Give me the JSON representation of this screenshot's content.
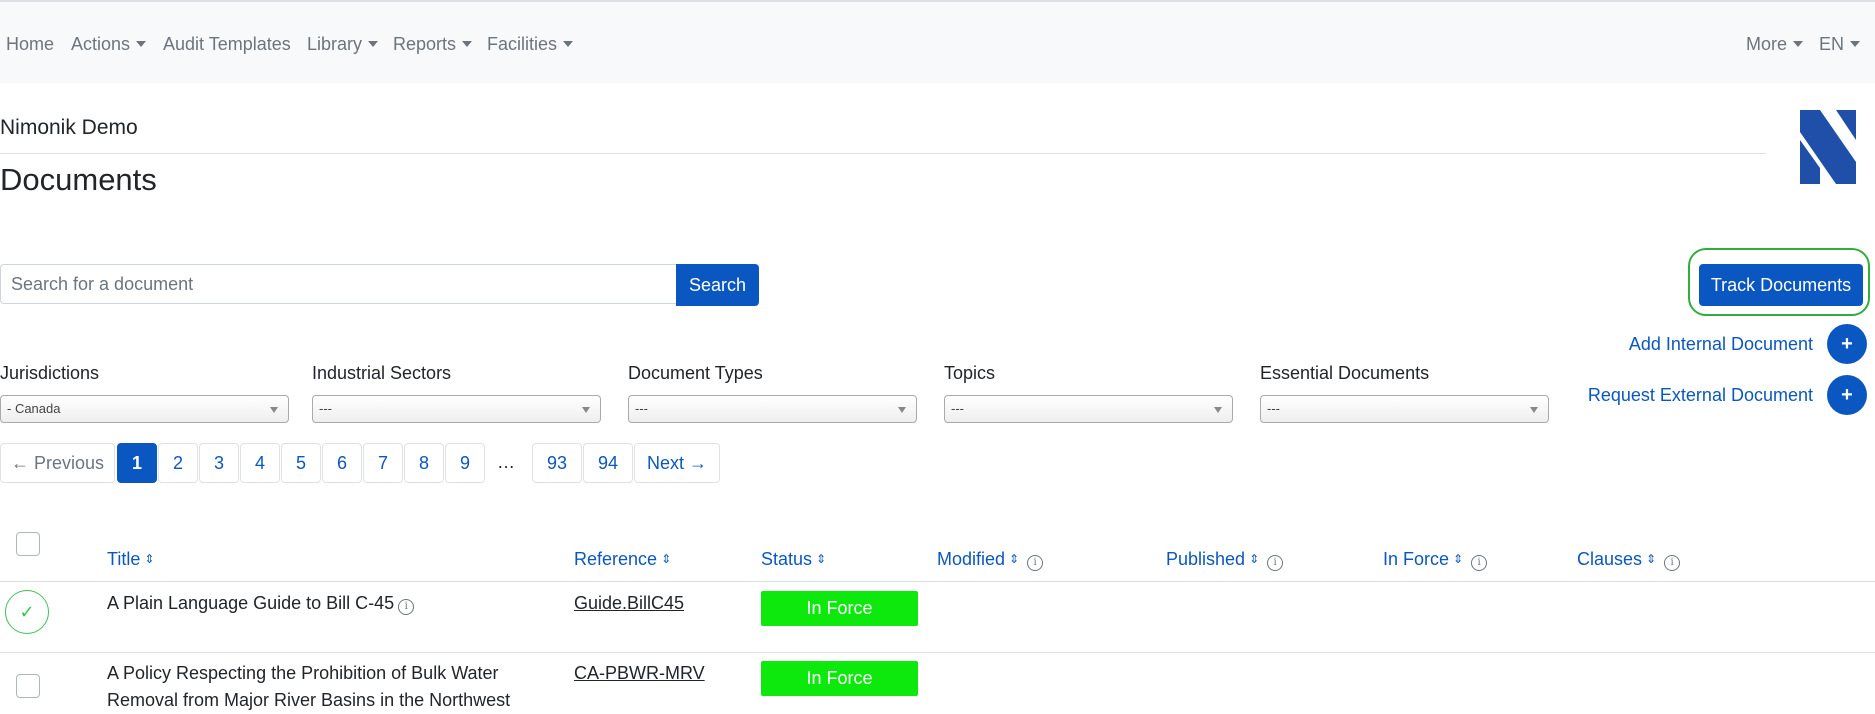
{
  "nav": {
    "items": [
      "Home",
      "Actions",
      "Audit Templates",
      "Library",
      "Reports",
      "Facilities"
    ],
    "right_items": [
      "More",
      "EN"
    ]
  },
  "org_name": "Nimonik Demo",
  "page_title": "Documents",
  "search": {
    "placeholder": "Search for a document",
    "button_label": "Search"
  },
  "track_button_label": "Track Documents",
  "add_internal_label": "Add Internal Document",
  "request_external_label": "Request External Document",
  "plus_symbol": "+",
  "filters": [
    {
      "label": "Jurisdictions",
      "value": "- Canada"
    },
    {
      "label": "Industrial Sectors",
      "value": "---"
    },
    {
      "label": "Document Types",
      "value": "---"
    },
    {
      "label": "Topics",
      "value": "---"
    },
    {
      "label": "Essential Documents",
      "value": "---"
    }
  ],
  "pagination": {
    "previous": "← Previous",
    "pages": [
      "1",
      "2",
      "3",
      "4",
      "5",
      "6",
      "7",
      "8",
      "9",
      "…",
      "93",
      "94"
    ],
    "current": "1",
    "next": "Next →"
  },
  "table": {
    "headers": [
      "Title",
      "Reference",
      "Status",
      "Modified",
      "Published",
      "In Force",
      "Clauses"
    ],
    "rows": [
      {
        "title": "A Plain Language Guide to Bill C-45",
        "reference": "Guide.BillC45",
        "status": "In Force",
        "selected": true
      },
      {
        "title_line1": "A Policy Respecting the Prohibition of Bulk Water",
        "title_line2": "Removal from Major River Basins in the Northwest",
        "reference": "CA-PBWR-MRV",
        "status": "In Force",
        "selected": false
      }
    ]
  },
  "colors": {
    "primary": "#0b57c1",
    "status_in_force": "#0de80d",
    "highlight": "#2fae3d"
  }
}
